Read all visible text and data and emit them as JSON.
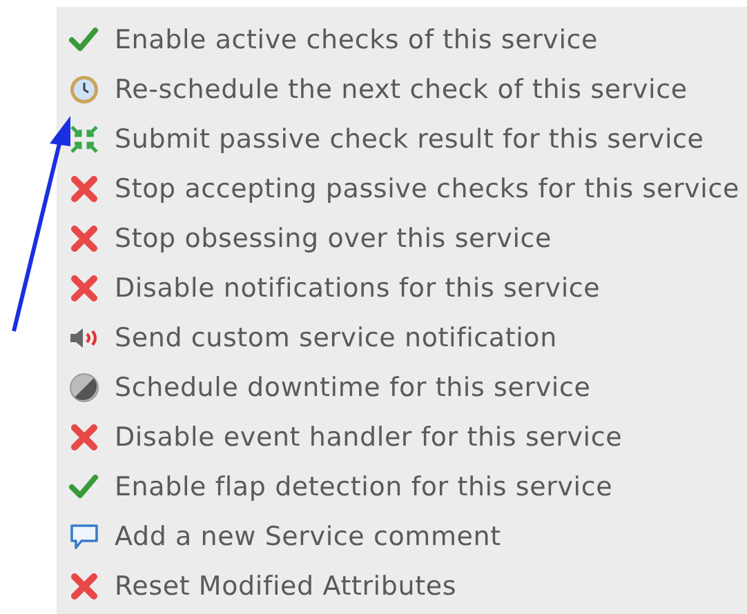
{
  "commands": [
    {
      "kind": "enable",
      "label": "Enable active checks of this service"
    },
    {
      "kind": "reschedule",
      "label": "Re-schedule the next check of this service"
    },
    {
      "kind": "submit",
      "label": "Submit passive check result for this service"
    },
    {
      "kind": "disable",
      "label": "Stop accepting passive checks for this service"
    },
    {
      "kind": "disable",
      "label": "Stop obsessing over this service"
    },
    {
      "kind": "disable",
      "label": "Disable notifications for this service"
    },
    {
      "kind": "notify",
      "label": "Send custom service notification"
    },
    {
      "kind": "downtime",
      "label": "Schedule downtime for this service"
    },
    {
      "kind": "disable",
      "label": "Disable event handler for this service"
    },
    {
      "kind": "enable",
      "label": "Enable flap detection for this service"
    },
    {
      "kind": "comment",
      "label": "Add a new Service comment"
    },
    {
      "kind": "disable",
      "label": "Reset Modified Attributes"
    }
  ]
}
